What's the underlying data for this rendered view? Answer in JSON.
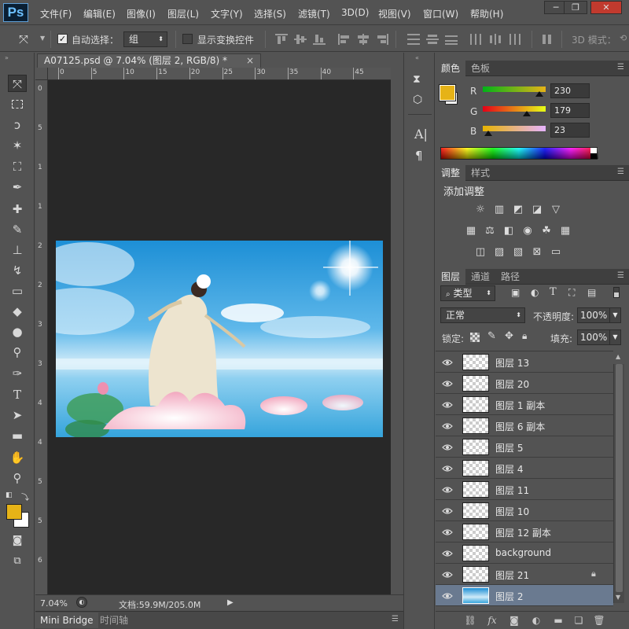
{
  "app": {
    "logo": "Ps"
  },
  "menu": [
    "文件(F)",
    "编辑(E)",
    "图像(I)",
    "图层(L)",
    "文字(Y)",
    "选择(S)",
    "滤镜(T)",
    "3D(D)",
    "视图(V)",
    "窗口(W)",
    "帮助(H)"
  ],
  "window_controls": {
    "minimize": "─",
    "restore": "❐",
    "close": "✕"
  },
  "options": {
    "auto_select_label": "自动选择：",
    "auto_select_checked": true,
    "auto_select_target": "组",
    "show_transform_label": "显示变换控件",
    "mode_3d_label": "3D 模式："
  },
  "document": {
    "tab_title": "A07125.psd @ 7.04% (图层 2, RGB/8) *",
    "tab_close": "×",
    "ruler_top": [
      "0",
      "5",
      "10",
      "15",
      "20",
      "25",
      "30",
      "35",
      "40",
      "45"
    ],
    "ruler_left": [
      "0",
      "5",
      "1",
      "1",
      "2",
      "2",
      "3",
      "3",
      "4",
      "4",
      "5",
      "5",
      "6"
    ],
    "zoom": "7.04%",
    "doc_size": "文档:59.9M/205.0M"
  },
  "bottom_tabs": [
    "Mini Bridge",
    "时间轴"
  ],
  "color_panel": {
    "tabs": [
      "颜色",
      "色板"
    ],
    "foreground": "#e6b317",
    "background": "#ffffff",
    "r_label": "R",
    "g_label": "G",
    "b_label": "B",
    "r": 230,
    "g": 179,
    "b": 23
  },
  "adjust_panel": {
    "tabs": [
      "调整",
      "样式"
    ],
    "heading": "添加调整"
  },
  "layers_panel": {
    "tabs": [
      "图层",
      "通道",
      "路径"
    ],
    "filter_kind": "类型",
    "blend_mode": "正常",
    "opacity_label": "不透明度:",
    "opacity_value": "100%",
    "lock_label": "锁定:",
    "fill_label": "填充:",
    "fill_value": "100%",
    "layers": [
      {
        "name": "图层 13",
        "locked": false,
        "selected": false
      },
      {
        "name": "图层 20",
        "locked": false,
        "selected": false
      },
      {
        "name": "图层 1 副本",
        "locked": false,
        "selected": false
      },
      {
        "name": "图层 6 副本",
        "locked": false,
        "selected": false
      },
      {
        "name": "图层 5",
        "locked": false,
        "selected": false
      },
      {
        "name": "图层 4",
        "locked": false,
        "selected": false
      },
      {
        "name": "图层 11",
        "locked": false,
        "selected": false
      },
      {
        "name": "图层 10",
        "locked": false,
        "selected": false
      },
      {
        "name": "图层 12 副本",
        "locked": false,
        "selected": false
      },
      {
        "name": "background",
        "locked": false,
        "selected": false
      },
      {
        "name": "图层 21",
        "locked": true,
        "selected": false
      },
      {
        "name": "图层 2",
        "locked": false,
        "selected": true
      }
    ]
  },
  "colors": {
    "accent": "#e6b317",
    "panel_bg": "#535353",
    "canvas_bg": "#282828",
    "selected_layer": "#6a7a90"
  }
}
